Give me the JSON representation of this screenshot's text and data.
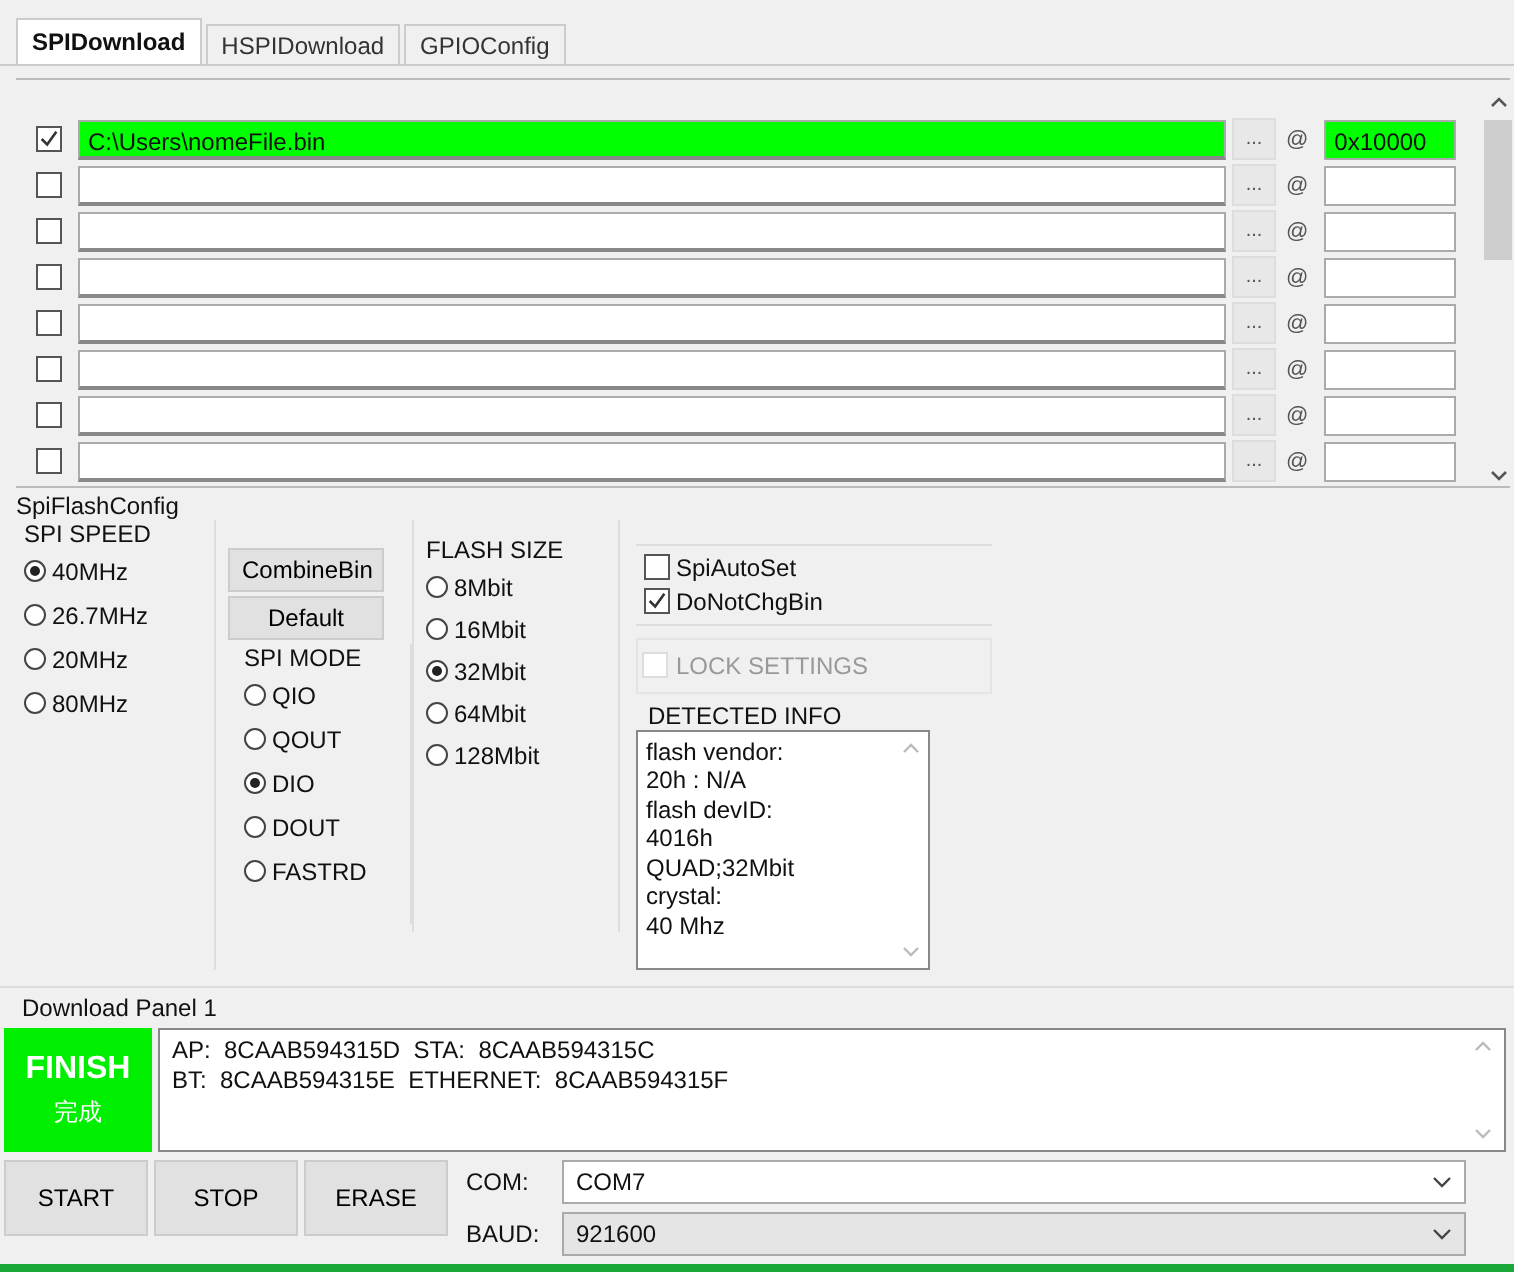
{
  "tabs": [
    {
      "label": "SPIDownload",
      "selected": true
    },
    {
      "label": "HSPIDownload",
      "selected": false
    },
    {
      "label": "GPIOConfig",
      "selected": false
    }
  ],
  "files": [
    {
      "checked": true,
      "path": "C:\\Users\\nomeFile.bin",
      "browse": "...",
      "at": "@",
      "address": "0x10000",
      "valid": true
    },
    {
      "checked": false,
      "browse": "...",
      "at": "@",
      "valid": false
    },
    {
      "checked": false,
      "browse": "...",
      "at": "@",
      "valid": false
    },
    {
      "checked": false,
      "browse": "...",
      "at": "@",
      "valid": false
    },
    {
      "checked": false,
      "browse": "...",
      "at": "@",
      "valid": false
    },
    {
      "checked": false,
      "browse": "...",
      "at": "@",
      "valid": false
    },
    {
      "checked": false,
      "browse": "...",
      "at": "@",
      "valid": false
    },
    {
      "checked": false,
      "browse": "...",
      "at": "@",
      "valid": false
    }
  ],
  "config": {
    "title": "SpiFlashConfig",
    "spi_speed": {
      "title": "SPI SPEED",
      "options": [
        {
          "label": "40MHz",
          "selected": true
        },
        {
          "label": "26.7MHz",
          "selected": false
        },
        {
          "label": "20MHz",
          "selected": false
        },
        {
          "label": "80MHz",
          "selected": false
        }
      ]
    },
    "buttons": [
      "CombineBin",
      "Default"
    ],
    "spi_mode": {
      "title": "SPI MODE",
      "options": [
        {
          "label": "QIO",
          "selected": false
        },
        {
          "label": "QOUT",
          "selected": false
        },
        {
          "label": "DIO",
          "selected": true
        },
        {
          "label": "DOUT",
          "selected": false
        },
        {
          "label": "FASTRD",
          "selected": false
        }
      ]
    },
    "flash_size": {
      "title": "FLASH SIZE",
      "options": [
        {
          "label": "8Mbit",
          "selected": false
        },
        {
          "label": "16Mbit",
          "selected": false
        },
        {
          "label": "32Mbit",
          "selected": true
        },
        {
          "label": "64Mbit",
          "selected": false
        },
        {
          "label": "128Mbit",
          "selected": false
        }
      ]
    },
    "checks": [
      {
        "label": "SpiAutoSet",
        "checked": false
      },
      {
        "label": "DoNotChgBin",
        "checked": true
      }
    ],
    "lock": {
      "label": "LOCK SETTINGS",
      "checked": false,
      "disabled": true
    },
    "detected": {
      "title": "DETECTED INFO",
      "lines": [
        "flash vendor:",
        "20h : N/A",
        "flash devID:",
        "4016h",
        "QUAD;32Mbit",
        "crystal:",
        "40 Mhz"
      ]
    }
  },
  "download": {
    "title": "Download Panel 1",
    "status": {
      "kind": "finish",
      "title": "FINISH",
      "subtitle": "完成"
    },
    "log": [
      "AP:  8CAAB594315D  STA:  8CAAB594315C",
      "BT:  8CAAB594315E  ETHERNET:  8CAAB594315F"
    ]
  },
  "actions": [
    "START",
    "STOP",
    "ERASE"
  ],
  "com": {
    "label": "COM:",
    "value": "COM7"
  },
  "baud": {
    "label": "BAUD:",
    "value": "921600"
  },
  "progress": {
    "level": 1
  }
}
